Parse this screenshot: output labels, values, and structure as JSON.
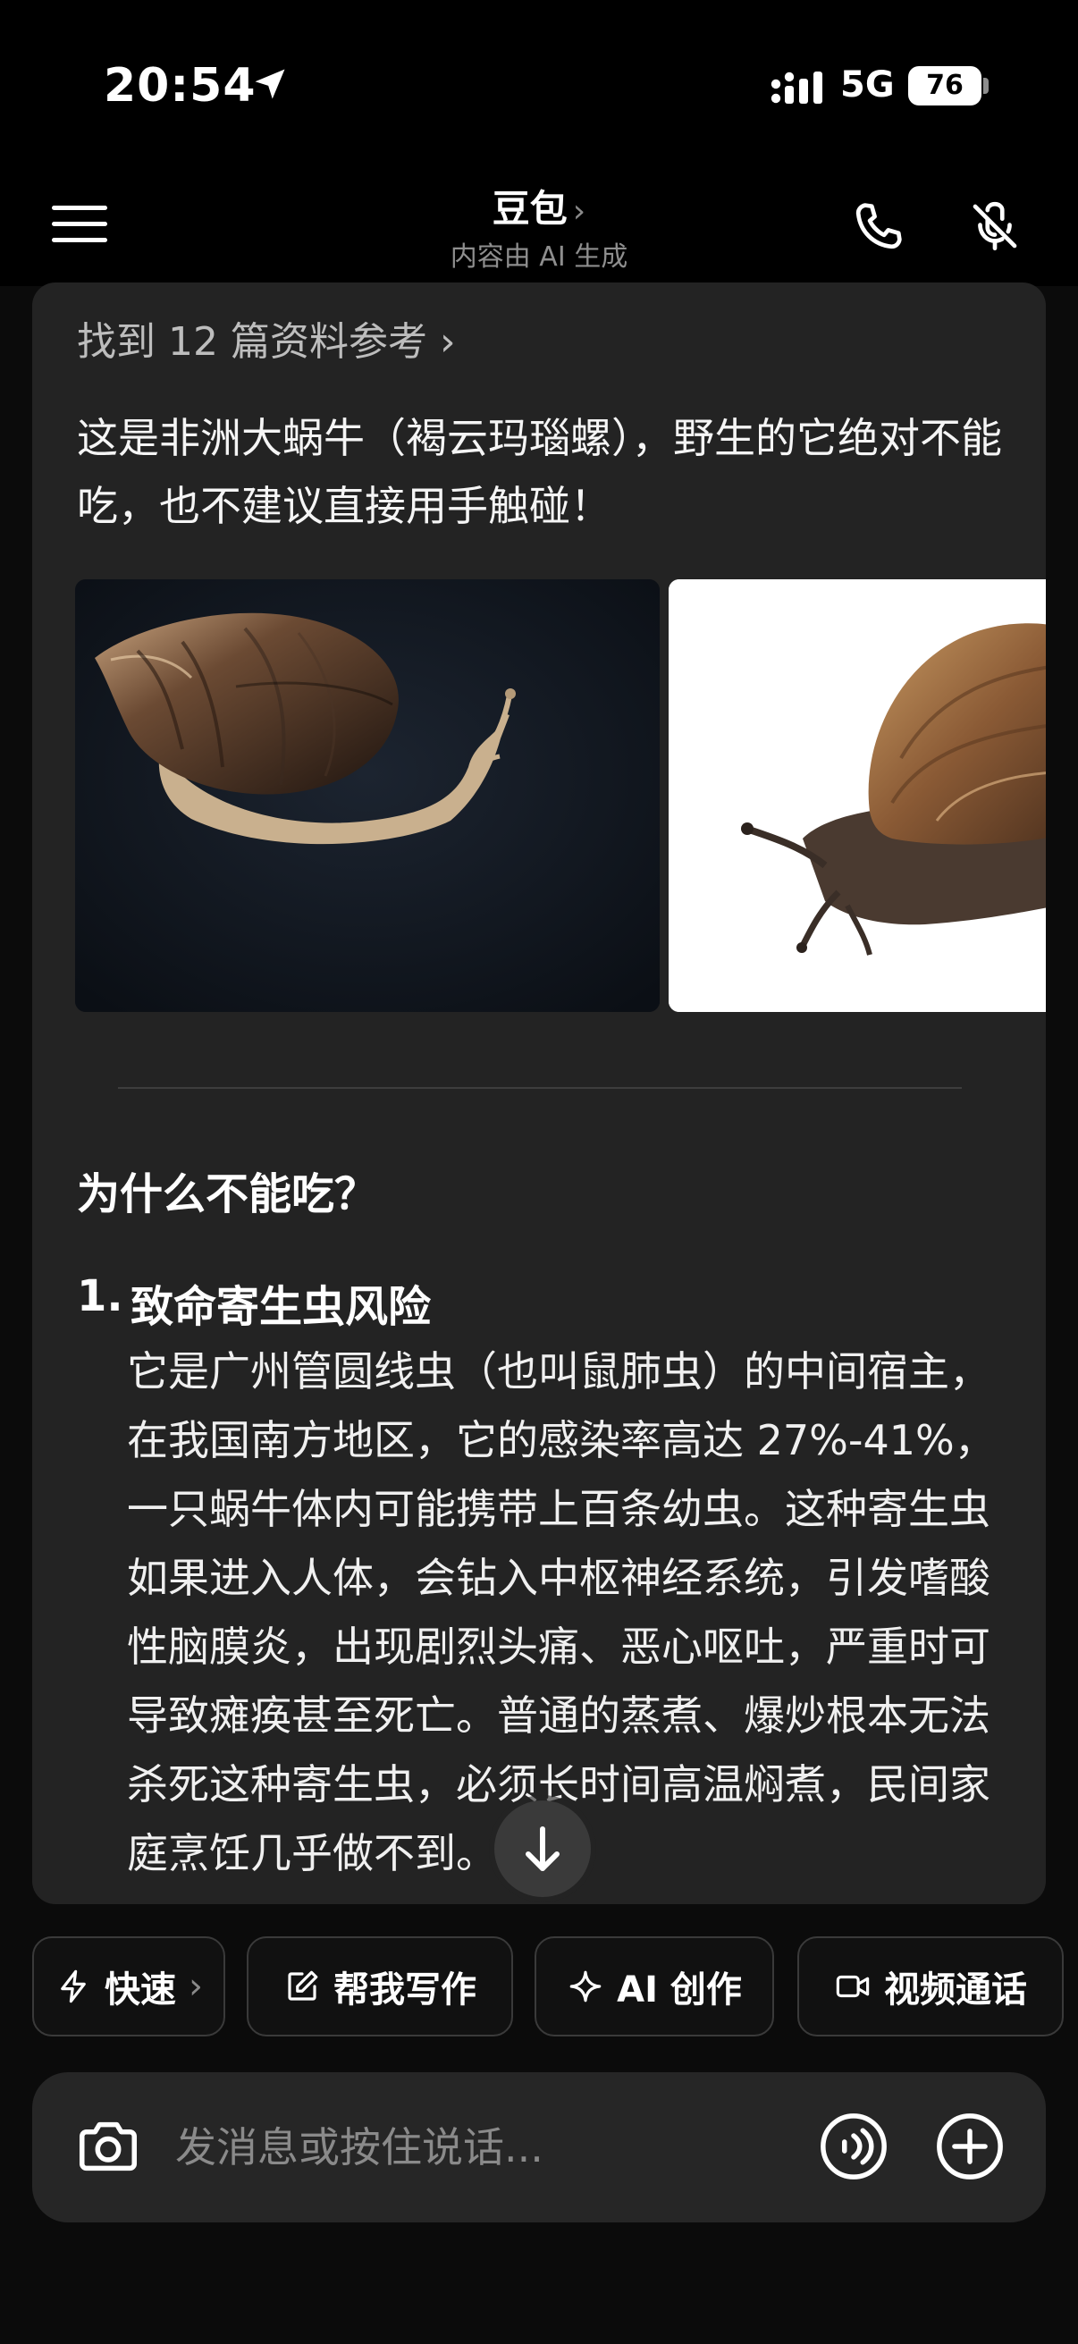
{
  "status_bar": {
    "time": "20:54",
    "network": "5G",
    "battery": "76"
  },
  "nav": {
    "title": "豆包",
    "title_chevron": "›",
    "subtitle": "内容由 AI 生成"
  },
  "chat": {
    "references": "找到 12 篇资料参考 ›",
    "intro": "这是非洲大蜗牛（褐云玛瑙螺），野生的它绝对不能吃，也不建议直接用手触碰！",
    "section_heading": "为什么不能吃？",
    "items": [
      {
        "number": "1.",
        "title": "致命寄生虫风险",
        "body": "它是广州管圆线虫（也叫鼠肺虫）的中间宿主，在我国南方地区，它的感染率高达 27%-41%，一只蜗牛体内可能携带上百条幼虫。这种寄生虫如果进入人体，会钻入中枢神经系统，引发嗜酸性脑膜炎，出现剧烈头痛、恶心呕吐，严重时可导致瘫痪甚至死亡。普通的蒸煮、爆炒根本无法杀死这种寄生虫，必须长时间高温焖煮，民间家庭烹饪几乎做不到。"
      }
    ]
  },
  "quick_actions": [
    {
      "label": "快速",
      "chevron": "›",
      "icon": "lightning-icon"
    },
    {
      "label": "帮我写作",
      "icon": "edit-icon"
    },
    {
      "label": "AI 创作",
      "icon": "sparkle-icon"
    },
    {
      "label": "视频通话",
      "icon": "video-icon"
    }
  ],
  "input": {
    "placeholder": "发消息或按住说话..."
  },
  "colors": {
    "background": "#0b0b0b",
    "card": "#232323",
    "input_bg": "#262626",
    "muted_text": "#8e8e8e"
  }
}
